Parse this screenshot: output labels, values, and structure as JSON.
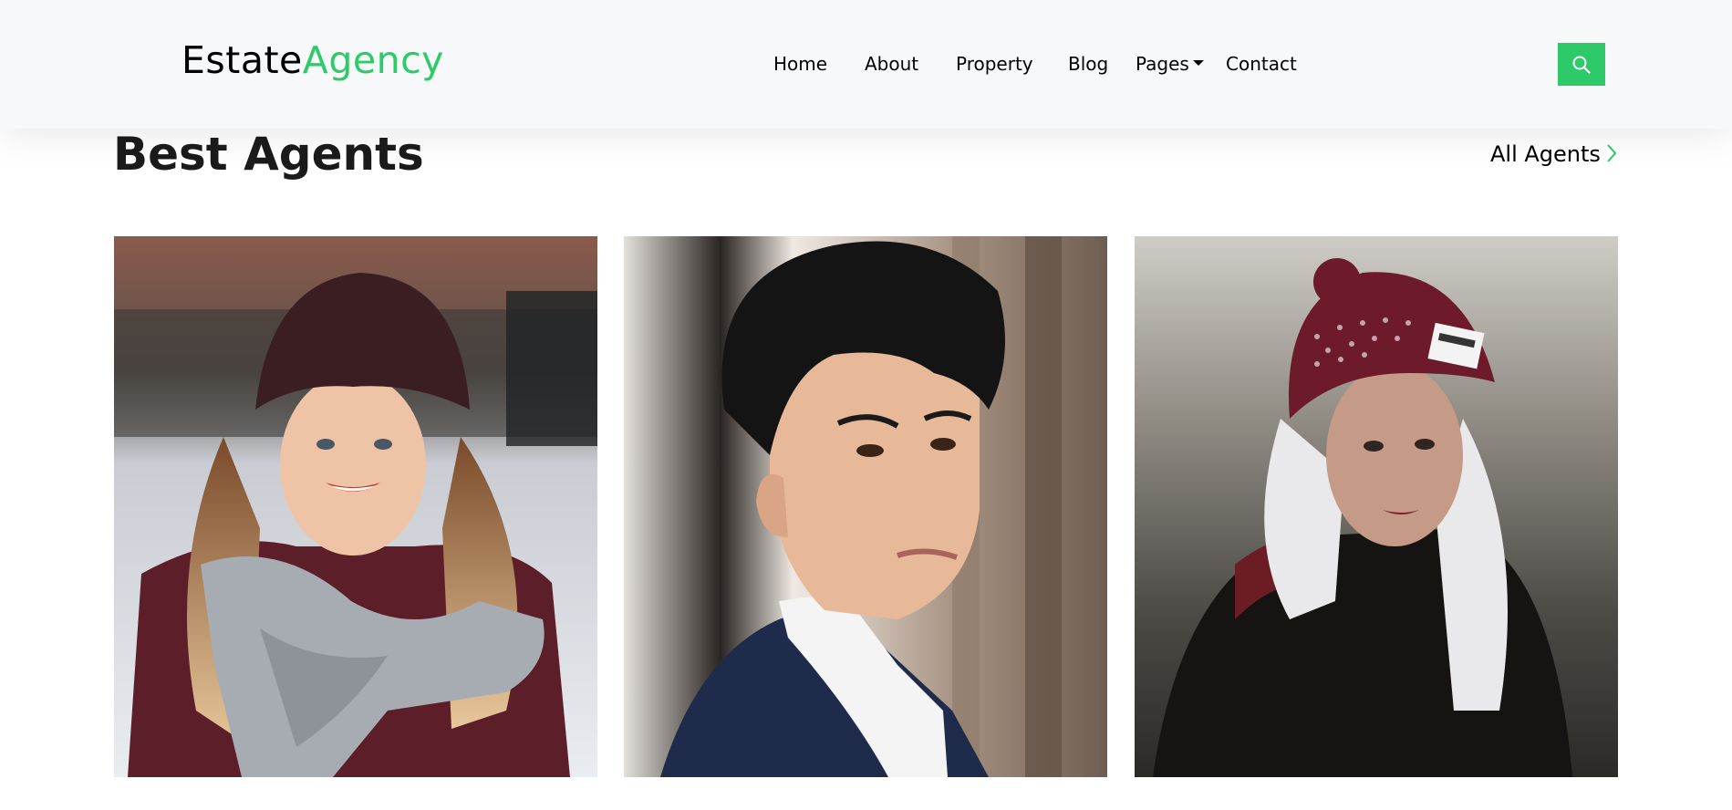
{
  "brand": {
    "part1": "Estate",
    "part2": "Agency",
    "color_dark": "#000000",
    "color_accent": "#2eca6a"
  },
  "nav": {
    "home": "Home",
    "about": "About",
    "property": "Property",
    "blog": "Blog",
    "pages": "Pages",
    "contact": "Contact"
  },
  "search": {
    "icon": "search-icon",
    "color": "#2eca6a"
  },
  "section": {
    "title": "Best Agents",
    "all_link": "All Agents",
    "all_link_icon": "chevron-right-icon"
  },
  "agents": [
    {
      "photo": "agent-photo-woman-scarf"
    },
    {
      "photo": "agent-photo-man-suit"
    },
    {
      "photo": "agent-photo-woman-beanie"
    }
  ],
  "colors": {
    "accent": "#2eca6a",
    "header_bg": "#f7f8f9"
  }
}
